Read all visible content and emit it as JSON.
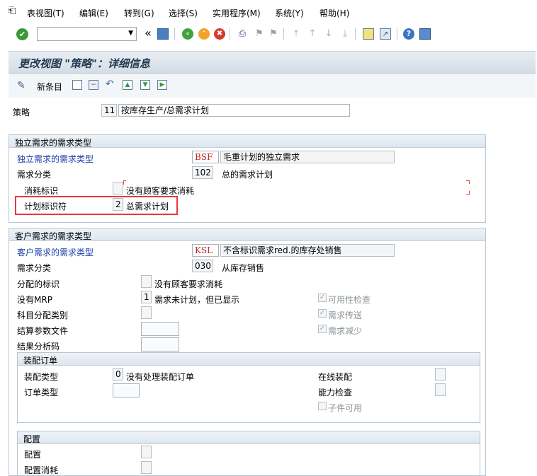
{
  "menu": {
    "table_view": "表视图(T)",
    "edit": "编辑(E)",
    "goto": "转到(G)",
    "select": "选择(S)",
    "utilities": "实用程序(M)",
    "system": "系统(Y)",
    "help": "帮助(H)"
  },
  "toolbar": {
    "command_value": ""
  },
  "title": "更改视图 \"策略\"：详细信息",
  "app_toolbar": {
    "new_entries": "新条目"
  },
  "strategy": {
    "label": "策略",
    "code": "11",
    "description": "按库存生产/总需求计划"
  },
  "indep_group": {
    "title": "独立需求的需求类型",
    "req_type_label": "独立需求的需求类型",
    "req_type_value": "BSF",
    "req_type_desc": "毛重计划的独立需求",
    "req_class_label": "需求分类",
    "req_class_value": "102",
    "req_class_desc": "总的需求计划",
    "consumption_label": "消耗标识",
    "consumption_value": "",
    "consumption_desc": "没有顾客要求消耗",
    "planning_ind_label": "计划标识符",
    "planning_ind_value": "2",
    "planning_ind_desc": "总需求计划"
  },
  "cust_group": {
    "title": "客户需求的需求类型",
    "req_type_label": "客户需求的需求类型",
    "req_type_value": "KSL",
    "req_type_desc": "不含标识需求red.的库存处销售",
    "req_class_label": "需求分类",
    "req_class_value": "030",
    "req_class_desc": "从库存销售",
    "alloc_ind_label": "分配的标识",
    "alloc_ind_desc": "没有顾客要求消耗",
    "no_mrp_label": "没有MRP",
    "no_mrp_value": "1",
    "no_mrp_desc": "需求未计划，但已显示",
    "acct_assign_label": "科目分配类别",
    "settle_profile_label": "结算参数文件",
    "result_analysis_label": "结果分析码",
    "availability_check": "可用性检查",
    "req_transfer": "需求传送",
    "req_reduction": "需求减少"
  },
  "assembly_group": {
    "title": "装配订单",
    "assembly_type_label": "装配类型",
    "assembly_type_value": "0",
    "assembly_type_desc": "没有处理装配订单",
    "order_type_label": "订单类型",
    "online_assembly_label": "在线装配",
    "capacity_check_label": "能力检查",
    "component_avail_label": "子件可用"
  },
  "config_group": {
    "title": "配置",
    "config_label": "配置",
    "config_consumption_label": "配置消耗"
  }
}
